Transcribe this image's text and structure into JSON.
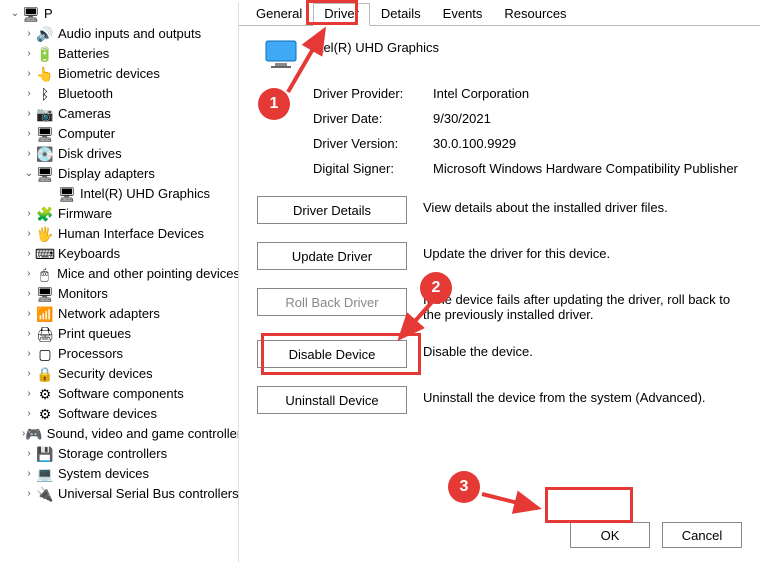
{
  "tree": {
    "root": "P",
    "items": [
      {
        "label": "Audio inputs and outputs",
        "icon": "🔊"
      },
      {
        "label": "Batteries",
        "icon": "🔋"
      },
      {
        "label": "Biometric devices",
        "icon": "👆"
      },
      {
        "label": "Bluetooth",
        "icon": "ᛒ"
      },
      {
        "label": "Cameras",
        "icon": "📷"
      },
      {
        "label": "Computer",
        "icon": "🖥"
      },
      {
        "label": "Disk drives",
        "icon": "💽"
      },
      {
        "label": "Display adapters",
        "icon": "🖥",
        "expanded": true,
        "children": [
          {
            "label": "Intel(R) UHD Graphics",
            "icon": "🖥"
          }
        ]
      },
      {
        "label": "Firmware",
        "icon": "🧩"
      },
      {
        "label": "Human Interface Devices",
        "icon": "🖐"
      },
      {
        "label": "Keyboards",
        "icon": "⌨"
      },
      {
        "label": "Mice and other pointing devices",
        "icon": "🖱"
      },
      {
        "label": "Monitors",
        "icon": "🖥"
      },
      {
        "label": "Network adapters",
        "icon": "📶"
      },
      {
        "label": "Print queues",
        "icon": "🖨"
      },
      {
        "label": "Processors",
        "icon": "▢"
      },
      {
        "label": "Security devices",
        "icon": "🔒"
      },
      {
        "label": "Software components",
        "icon": "⚙"
      },
      {
        "label": "Software devices",
        "icon": "⚙"
      },
      {
        "label": "Sound, video and game controllers",
        "icon": "🎮"
      },
      {
        "label": "Storage controllers",
        "icon": "💾"
      },
      {
        "label": "System devices",
        "icon": "💻"
      },
      {
        "label": "Universal Serial Bus controllers",
        "icon": "🔌"
      }
    ]
  },
  "tabs": {
    "items": [
      "General",
      "Driver",
      "Details",
      "Events",
      "Resources"
    ],
    "active": "Driver"
  },
  "device": {
    "name": "Intel(R) UHD Graphics"
  },
  "props": {
    "provider_k": "Driver Provider:",
    "provider_v": "Intel Corporation",
    "date_k": "Driver Date:",
    "date_v": "9/30/2021",
    "version_k": "Driver Version:",
    "version_v": "30.0.100.9929",
    "signer_k": "Digital Signer:",
    "signer_v": "Microsoft Windows Hardware Compatibility Publisher"
  },
  "actions": {
    "details": {
      "label": "Driver Details",
      "desc": "View details about the installed driver files."
    },
    "update": {
      "label": "Update Driver",
      "desc": "Update the driver for this device."
    },
    "rollback": {
      "label": "Roll Back Driver",
      "desc": "If the device fails after updating the driver, roll back to the previously installed driver."
    },
    "disable": {
      "label": "Disable Device",
      "desc": "Disable the device."
    },
    "uninstall": {
      "label": "Uninstall Device",
      "desc": "Uninstall the device from the system (Advanced)."
    }
  },
  "buttons": {
    "ok": "OK",
    "cancel": "Cancel"
  },
  "annotations": {
    "1": "1",
    "2": "2",
    "3": "3"
  }
}
